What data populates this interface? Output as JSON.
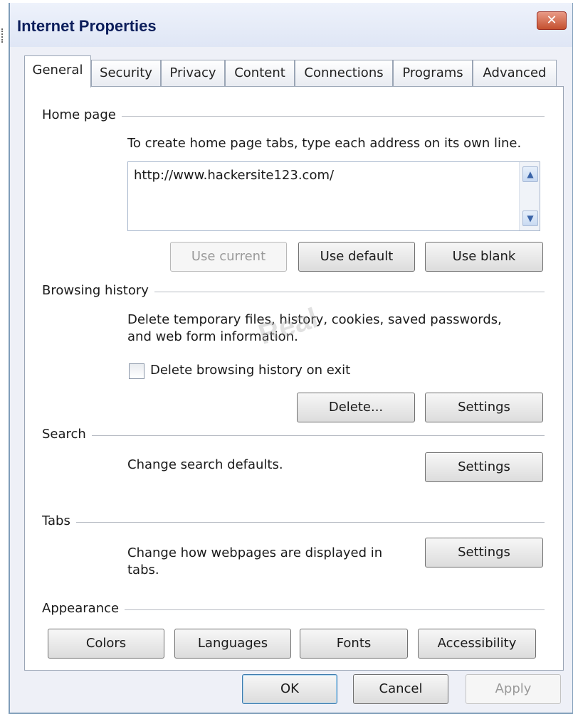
{
  "window": {
    "title": "Internet Properties",
    "close_glyph": "✕"
  },
  "tabs": [
    {
      "label": "General"
    },
    {
      "label": "Security"
    },
    {
      "label": "Privacy"
    },
    {
      "label": "Content"
    },
    {
      "label": "Connections"
    },
    {
      "label": "Programs"
    },
    {
      "label": "Advanced"
    }
  ],
  "home_page": {
    "group_label": "Home page",
    "instruction": "To create home page tabs, type each address on its own line.",
    "address_value": "http://www.hackersite123.com/",
    "use_current_label": "Use current",
    "use_default_label": "Use default",
    "use_blank_label": "Use blank"
  },
  "browsing_history": {
    "group_label": "Browsing history",
    "desc_line1": "Delete temporary files, history, cookies, saved passwords,",
    "desc_line2": "and web form information.",
    "checkbox_label": "Delete browsing history on exit",
    "checkbox_checked": false,
    "delete_label": "Delete...",
    "settings_label": "Settings"
  },
  "search": {
    "group_label": "Search",
    "desc": "Change search defaults.",
    "settings_label": "Settings"
  },
  "tabs_group": {
    "group_label": "Tabs",
    "desc_line1": "Change how webpages are displayed in",
    "desc_line2": "tabs.",
    "settings_label": "Settings"
  },
  "appearance": {
    "group_label": "Appearance",
    "colors_label": "Colors",
    "languages_label": "Languages",
    "fonts_label": "Fonts",
    "accessibility_label": "Accessibility"
  },
  "watermark": "Real",
  "footer": {
    "ok_label": "OK",
    "cancel_label": "Cancel",
    "apply_label": "Apply"
  },
  "icons": {
    "scroll_up": "▲",
    "scroll_down": "▼"
  },
  "colors": {
    "title_text": "#0d1f5c",
    "close_button": "#c4502f",
    "panel_bg": "#ffffff",
    "dialog_bg": "#eef0f7"
  }
}
